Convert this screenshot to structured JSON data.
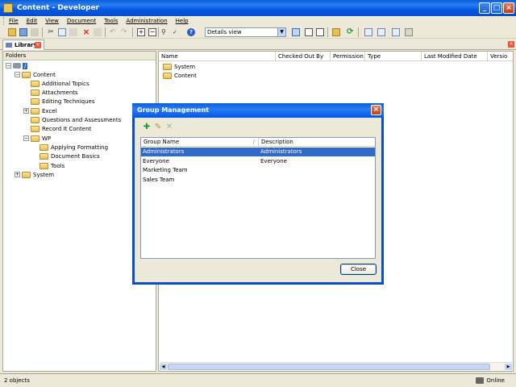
{
  "window": {
    "title": "Content - Developer"
  },
  "menu": [
    "File",
    "Edit",
    "View",
    "Document",
    "Tools",
    "Administration",
    "Help"
  ],
  "toolbar": {
    "view_mode": "Details view"
  },
  "tab": {
    "label": "Library"
  },
  "folders_panel": {
    "header": "Folders",
    "root": "/",
    "tree": [
      {
        "label": "Content",
        "depth": 1,
        "expander": "−"
      },
      {
        "label": "Additional Topics",
        "depth": 2,
        "expander": ""
      },
      {
        "label": "Attachments",
        "depth": 2,
        "expander": ""
      },
      {
        "label": "Editing Techniques",
        "depth": 2,
        "expander": ""
      },
      {
        "label": "Excel",
        "depth": 2,
        "expander": "+"
      },
      {
        "label": "Questions and Assessments",
        "depth": 2,
        "expander": ""
      },
      {
        "label": "Record It Content",
        "depth": 2,
        "expander": ""
      },
      {
        "label": "WP",
        "depth": 2,
        "expander": "−"
      },
      {
        "label": "Applying Formatting",
        "depth": 3,
        "expander": ""
      },
      {
        "label": "Document Basics",
        "depth": 3,
        "expander": ""
      },
      {
        "label": "Tools",
        "depth": 3,
        "expander": ""
      },
      {
        "label": "System",
        "depth": 1,
        "expander": "+"
      }
    ]
  },
  "list_panel": {
    "columns": [
      "Name",
      "Checked Out By",
      "Permission",
      "Type",
      "Last Modified Date",
      "Versio"
    ],
    "rows": [
      "System",
      "Content"
    ]
  },
  "dialog": {
    "title": "Group Management",
    "columns": [
      "Group Name",
      "Description"
    ],
    "rows": [
      {
        "name": "Administrators",
        "description": "Administrators",
        "selected": true
      },
      {
        "name": "Everyone",
        "description": "Everyone",
        "selected": false
      },
      {
        "name": "Marketing Team",
        "description": "",
        "selected": false
      },
      {
        "name": "Sales Team",
        "description": "",
        "selected": false
      }
    ],
    "close_label": "Close"
  },
  "status": {
    "count": "2 objects",
    "connection": "Online"
  },
  "colors": {
    "titlebar": "#0058e6",
    "selection": "#316ac5",
    "folder": "#e8c052"
  }
}
